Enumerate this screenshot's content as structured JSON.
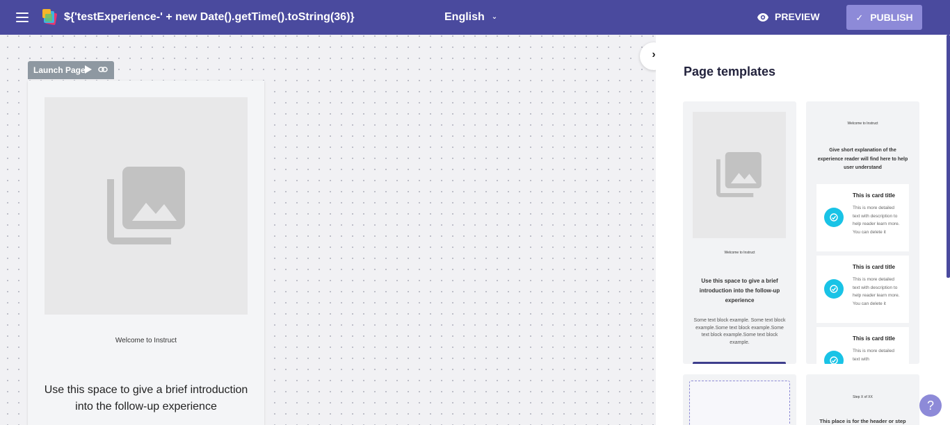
{
  "header": {
    "title": "${'testExperience-' + new Date().getTime().toString(36)}",
    "language": "English",
    "preview_label": "PREVIEW",
    "publish_label": "PUBLISH"
  },
  "canvas": {
    "page_tab_label": "Launch Page",
    "page": {
      "welcome": "Welcome to Instruct",
      "intro": "Use this space to give a brief introduction into the follow-up experience"
    }
  },
  "panel": {
    "title": "Page templates",
    "templates": [
      {
        "welcome": "Welcome to Instruct",
        "intro": "Use this space to give a brief introduction into the follow-up experience",
        "body": "Some text block example. Some text block example.Some text block example.Some text block example.Some text block example."
      },
      {
        "welcome": "Welcome to Instruct",
        "description": "Give short explanation of the experience reader will find here to help user understand",
        "cards": [
          {
            "title": "This is card title",
            "text": "This is more detailed text with description to help reader learn more. You can delete it"
          },
          {
            "title": "This is card title",
            "text": "This is more detailed text with description to help reader learn more. You can delete it"
          },
          {
            "title": "This is card title",
            "text": "This is more detailed text with"
          }
        ]
      },
      {},
      {
        "step": "Step X of XX",
        "heading": "This place is for the header or step"
      }
    ]
  },
  "help_label": "?",
  "colors": {
    "topbar": "#4a4a9e",
    "publish": "#8d8ad8",
    "card_icon": "#19c3e6"
  },
  "icons": {
    "menu": "hamburger-icon",
    "preview": "eye-icon",
    "publish": "check-icon",
    "language": "chevron-down-icon",
    "collapse": "chevron-right-icon",
    "play": "play-icon",
    "link": "link-icon",
    "placeholder": "image-gallery-icon"
  }
}
